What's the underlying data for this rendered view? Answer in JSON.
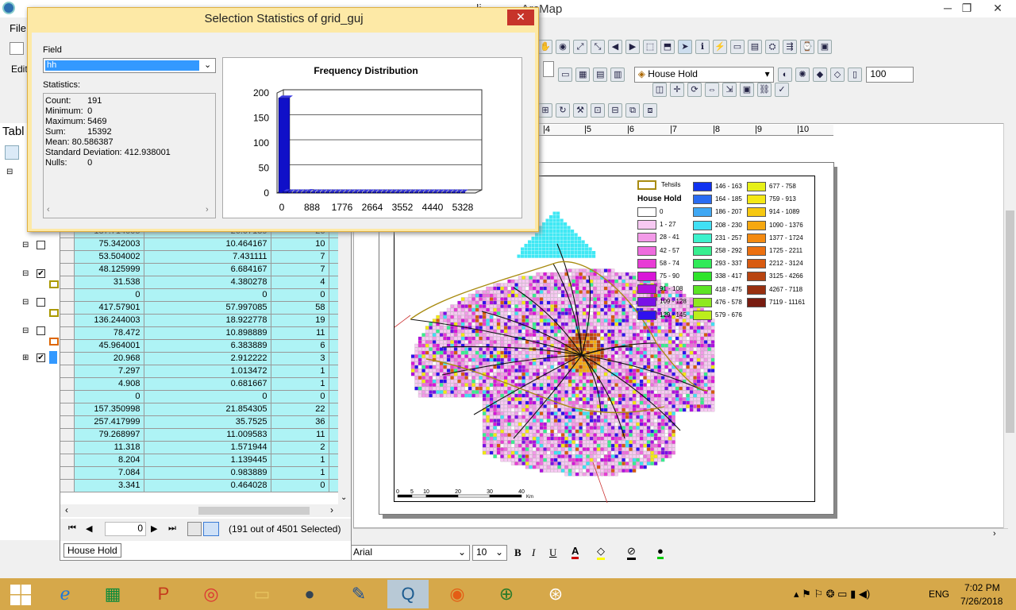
{
  "app": {
    "title": "ArcMap",
    "title_prefix": "li",
    "minimize": "─",
    "maximize": "❐",
    "close": "✕"
  },
  "menu": {
    "file": "File",
    "edit": "Edit"
  },
  "toc": {
    "title": "Tabl"
  },
  "toolbar": {
    "layer_select": "House Hold",
    "zoom_value": "100"
  },
  "ruler": {
    "ticks": [
      "|4",
      "|5",
      "|6",
      "|7",
      "|8",
      "|9",
      "|10"
    ]
  },
  "dialog": {
    "title": "Selection Statistics of grid_guj",
    "field_label": "Field",
    "field_value": "hh",
    "statistics_label": "Statistics:",
    "stats": [
      {
        "k": "Count:",
        "v": "191"
      },
      {
        "k": "Minimum:",
        "v": "0"
      },
      {
        "k": "Maximum:",
        "v": "5469"
      },
      {
        "k": "Sum:",
        "v": "15392"
      },
      {
        "k": "Mean:",
        "v": "80.586387"
      },
      {
        "k": "Standard Deviation:",
        "v": "412.938001"
      },
      {
        "k": "Nulls:",
        "v": "0"
      }
    ],
    "close": "✕"
  },
  "chart_data": {
    "type": "bar",
    "title": "Frequency Distribution",
    "xlabel": "",
    "ylabel": "",
    "x_ticks": [
      "0",
      "888",
      "1776",
      "2664",
      "3552",
      "4440",
      "5328"
    ],
    "y_ticks": [
      "0",
      "50",
      "100",
      "150",
      "200"
    ],
    "ylim": [
      0,
      200
    ],
    "values": [
      190,
      3,
      2,
      2,
      2,
      2,
      3,
      2,
      2,
      2,
      1,
      1,
      1,
      1,
      1,
      1,
      1,
      1,
      1,
      1,
      1,
      1,
      2,
      1,
      1,
      1,
      1,
      1,
      1,
      1,
      1,
      1,
      1,
      1,
      1,
      2,
      1,
      1,
      1,
      2
    ],
    "color": "#1010c8"
  },
  "table": {
    "rows": [
      [
        "187.714005",
        "26.07139",
        "26"
      ],
      [
        "75.342003",
        "10.464167",
        "10"
      ],
      [
        "53.504002",
        "7.431111",
        "7"
      ],
      [
        "48.125999",
        "6.684167",
        "7"
      ],
      [
        "31.538",
        "4.380278",
        "4"
      ],
      [
        "0",
        "0",
        "0"
      ],
      [
        "417.57901",
        "57.997085",
        "58"
      ],
      [
        "136.244003",
        "18.922778",
        "19"
      ],
      [
        "78.472",
        "10.898889",
        "11"
      ],
      [
        "45.964001",
        "6.383889",
        "6"
      ],
      [
        "20.968",
        "2.912222",
        "3"
      ],
      [
        "7.297",
        "1.013472",
        "1"
      ],
      [
        "4.908",
        "0.681667",
        "1"
      ],
      [
        "0",
        "0",
        "0"
      ],
      [
        "157.350998",
        "21.854305",
        "22"
      ],
      [
        "257.417999",
        "35.7525",
        "36"
      ],
      [
        "79.268997",
        "11.009583",
        "11"
      ],
      [
        "11.318",
        "1.571944",
        "2"
      ],
      [
        "8.204",
        "1.139445",
        "1"
      ],
      [
        "7.084",
        "0.983889",
        "1"
      ],
      [
        "3.341",
        "0.464028",
        "0"
      ]
    ],
    "record": "0",
    "selected_text": "(191 out of 4501 Selected)",
    "tab_label": "House Hold"
  },
  "legend": {
    "tehsils": "Tehsils",
    "title": "House Hold",
    "col1": [
      {
        "label": "0",
        "color": "#ffffff"
      },
      {
        "label": "1 - 27",
        "color": "#f7c9f2"
      },
      {
        "label": "28 - 41",
        "color": "#f39ae8"
      },
      {
        "label": "42 - 57",
        "color": "#ee6cde"
      },
      {
        "label": "58 - 74",
        "color": "#e83cd5"
      },
      {
        "label": "75 - 90",
        "color": "#d916d8"
      },
      {
        "label": "91 - 108",
        "color": "#b00fe0"
      },
      {
        "label": "109 - 128",
        "color": "#7a10e6"
      },
      {
        "label": "129 - 145",
        "color": "#3010ee"
      }
    ],
    "col2": [
      {
        "label": "146 - 163",
        "color": "#1032f0"
      },
      {
        "label": "164 - 185",
        "color": "#2a6cf2"
      },
      {
        "label": "186 - 207",
        "color": "#40a8f4"
      },
      {
        "label": "208 - 230",
        "color": "#40e0f4"
      },
      {
        "label": "231 - 257",
        "color": "#3cf2cc"
      },
      {
        "label": "258 - 292",
        "color": "#38ee90"
      },
      {
        "label": "293 - 337",
        "color": "#30ea58"
      },
      {
        "label": "338 - 417",
        "color": "#2ee42a"
      },
      {
        "label": "418 - 475",
        "color": "#5ce424"
      },
      {
        "label": "476 - 578",
        "color": "#8ee820"
      },
      {
        "label": "579 - 676",
        "color": "#bcee1c"
      }
    ],
    "col3": [
      {
        "label": "677 - 758",
        "color": "#e6f018"
      },
      {
        "label": "759 - 913",
        "color": "#f4e814"
      },
      {
        "label": "914 - 1089",
        "color": "#f6c810"
      },
      {
        "label": "1090 - 1376",
        "color": "#f6a810"
      },
      {
        "label": "1377 - 1724",
        "color": "#f48a10"
      },
      {
        "label": "1725 - 2211",
        "color": "#ec7010"
      },
      {
        "label": "2212 - 3124",
        "color": "#d85a10"
      },
      {
        "label": "3125 - 4266",
        "color": "#b84410"
      },
      {
        "label": "4267 - 7118",
        "color": "#983010"
      },
      {
        "label": "7119 - 11161",
        "color": "#781c10"
      }
    ],
    "scale_ticks": [
      "0",
      "5",
      "10",
      "20",
      "30",
      "40"
    ],
    "scale_unit": "Km"
  },
  "format_bar": {
    "font": "Arial",
    "size": "10",
    "bold": "B",
    "italic": "I",
    "underline": "U",
    "font_color_glyph": "A"
  },
  "taskbar": {
    "lang": "ENG",
    "time": "7:02 PM",
    "date": "7/26/2018"
  }
}
